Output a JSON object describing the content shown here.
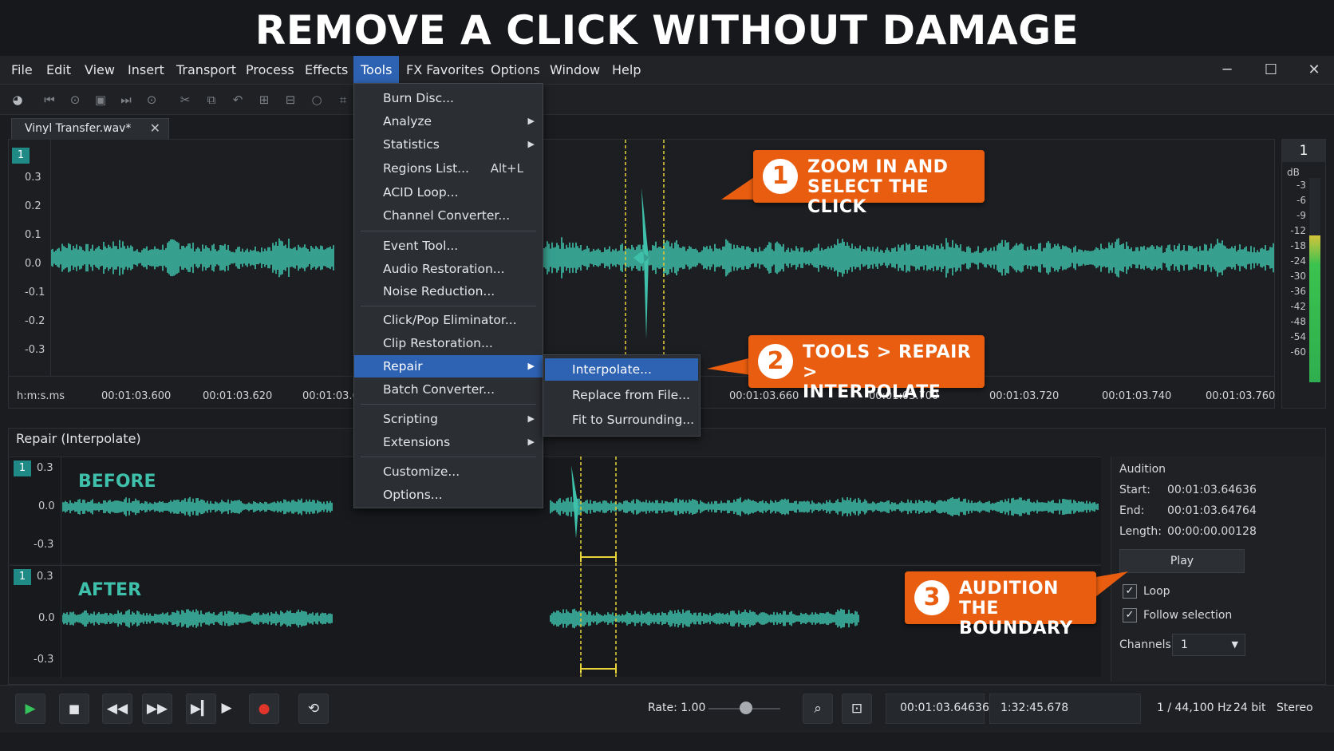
{
  "banner": {
    "title": "REMOVE A CLICK WITHOUT DAMAGE"
  },
  "menubar": {
    "items": [
      "File",
      "Edit",
      "View",
      "Insert",
      "Transport",
      "Process",
      "Effects",
      "Tools",
      "FX Favorites",
      "Options",
      "Window",
      "Help"
    ],
    "active": "Tools"
  },
  "window_controls": {
    "minimize": "─",
    "maximize": "☐",
    "close": "✕"
  },
  "tab": {
    "label": "Vinyl Transfer.wav*",
    "close": "✕"
  },
  "main_wave": {
    "channel": "1",
    "y_ticks": [
      "0.3",
      "0.2",
      "0.1",
      "0.0",
      "-0.1",
      "-0.2",
      "-0.3"
    ],
    "time_format": "h:m:s.ms",
    "time_labels": [
      "00:01:03.600",
      "00:01:03.620",
      "00:01:03.6",
      "00:01:03.660",
      "00:01:03.700",
      "00:01:03.720",
      "00:01:03.740",
      "00:01:03.760"
    ],
    "wave_color": "#3ec0aa"
  },
  "meter": {
    "channel": "1",
    "unit": "dB",
    "labels": [
      "-3",
      "-6",
      "-9",
      "-12",
      "-18",
      "-24",
      "-30",
      "-36",
      "-42",
      "-48",
      "-54",
      "-60"
    ],
    "level_fraction": 0.72
  },
  "tools_menu": {
    "items": [
      {
        "label": "Burn Disc..."
      },
      {
        "label": "Analyze",
        "submenu": true
      },
      {
        "label": "Statistics",
        "submenu": true
      },
      {
        "label": "Regions List...",
        "shortcut": "Alt+L"
      },
      {
        "label": "ACID Loop..."
      },
      {
        "label": "Channel Converter..."
      },
      {
        "label": "Event Tool..."
      },
      {
        "label": "Audio Restoration..."
      },
      {
        "label": "Noise Reduction..."
      },
      {
        "label": "Click/Pop Eliminator..."
      },
      {
        "label": "Clip Restoration..."
      },
      {
        "label": "Repair",
        "submenu": true,
        "highlighted": true
      },
      {
        "label": "Batch Converter..."
      },
      {
        "label": "Scripting",
        "submenu": true
      },
      {
        "label": "Extensions",
        "submenu": true
      },
      {
        "label": "Customize..."
      },
      {
        "label": "Options..."
      }
    ]
  },
  "repair_submenu": {
    "items": [
      "Interpolate...",
      "Replace from File...",
      "Fit to Surrounding..."
    ],
    "highlighted": "Interpolate..."
  },
  "callouts": [
    {
      "num": "1",
      "line1": "ZOOM IN AND",
      "line2": "SELECT THE CLICK"
    },
    {
      "num": "2",
      "line1": "TOOLS > REPAIR >",
      "line2": "INTERPOLATE"
    },
    {
      "num": "3",
      "line1": "AUDITION THE",
      "line2": "BOUNDARY"
    }
  ],
  "repair_panel": {
    "title": "Repair (Interpolate)",
    "before": {
      "channel": "1",
      "label": "BEFORE",
      "ticks": [
        "0.3",
        "0.0",
        "-0.3"
      ]
    },
    "after": {
      "channel": "1",
      "label": "AFTER",
      "ticks": [
        "0.3",
        "0.0",
        "-0.3"
      ]
    }
  },
  "audition": {
    "title": "Audition",
    "start_label": "Start:",
    "start": "00:01:03.64636",
    "end_label": "End:",
    "end": "00:01:03.64764",
    "length_label": "Length:",
    "length": "00:00:00.00128",
    "play": "Play",
    "loop": "Loop",
    "loop_checked": true,
    "follow": "Follow selection",
    "follow_checked": true,
    "channels_label": "Channels:",
    "channels_value": "1"
  },
  "transport": {
    "rate": "Rate: 1.00",
    "position": "00:01:03.64636",
    "length": "1:32:45.678",
    "format": "1 / 44,100 Hz",
    "bits": "24 bit",
    "channels": "Stereo"
  },
  "colors": {
    "accent": "#2e63b3",
    "wave": "#3ec0aa",
    "callout": "#e85d0f",
    "selection": "#e8d43a"
  }
}
